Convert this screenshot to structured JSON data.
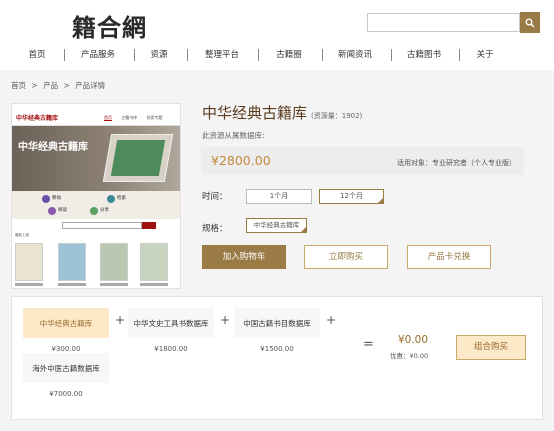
{
  "header": {
    "logo": "籍合網",
    "search": {
      "placeholder": "",
      "icon": "search-icon"
    },
    "nav": [
      "首页",
      "产品服务",
      "资源",
      "整理平台",
      "古籍圈",
      "新闻资讯",
      "古籍图书",
      "关于"
    ]
  },
  "breadcrumb": [
    "首页",
    ">",
    "产品",
    ">",
    "产品详情"
  ],
  "preview": {
    "site_title": "中华经典古籍库",
    "tabs": [
      "首页",
      "古籍书库",
      "检索专题"
    ],
    "banner_title": "中华经典古籍库",
    "menu": [
      "移动",
      "检索",
      "阅读",
      "分享"
    ],
    "list_header": "最新上架"
  },
  "product": {
    "title": "中华经典古籍库",
    "stock": "(资源量：1902)",
    "source": "此资源从属数据库:",
    "price": "¥2800.00",
    "audience": "适用对象：专业研究者（个人专业版）",
    "time_label": "时间：",
    "time_options": [
      "1个月",
      "12个月"
    ],
    "time_selected": "12个月",
    "spec_label": "规格：",
    "spec_option": "中华经典古籍库",
    "buttons": {
      "cart": "加入购物车",
      "buy": "立即购买",
      "card": "产品卡兑换"
    }
  },
  "combo": {
    "items": [
      {
        "name": "中华经典古籍库",
        "price": "¥300.00"
      },
      {
        "name": "中华文史工具书数据库",
        "price": "¥1800.00"
      },
      {
        "name": "中国古籍书目数据库",
        "price": "¥1500.00"
      },
      {
        "name": "海外中医古籍数据库",
        "price": "¥7000.00"
      }
    ],
    "plus": "+",
    "equals": "=",
    "total": "¥0.00",
    "discount": "优惠：¥0.00",
    "button": "组合购买"
  },
  "colors": {
    "accent": "#9a7a45",
    "price": "#c28a3c",
    "active_bg": "#fde8c8"
  }
}
